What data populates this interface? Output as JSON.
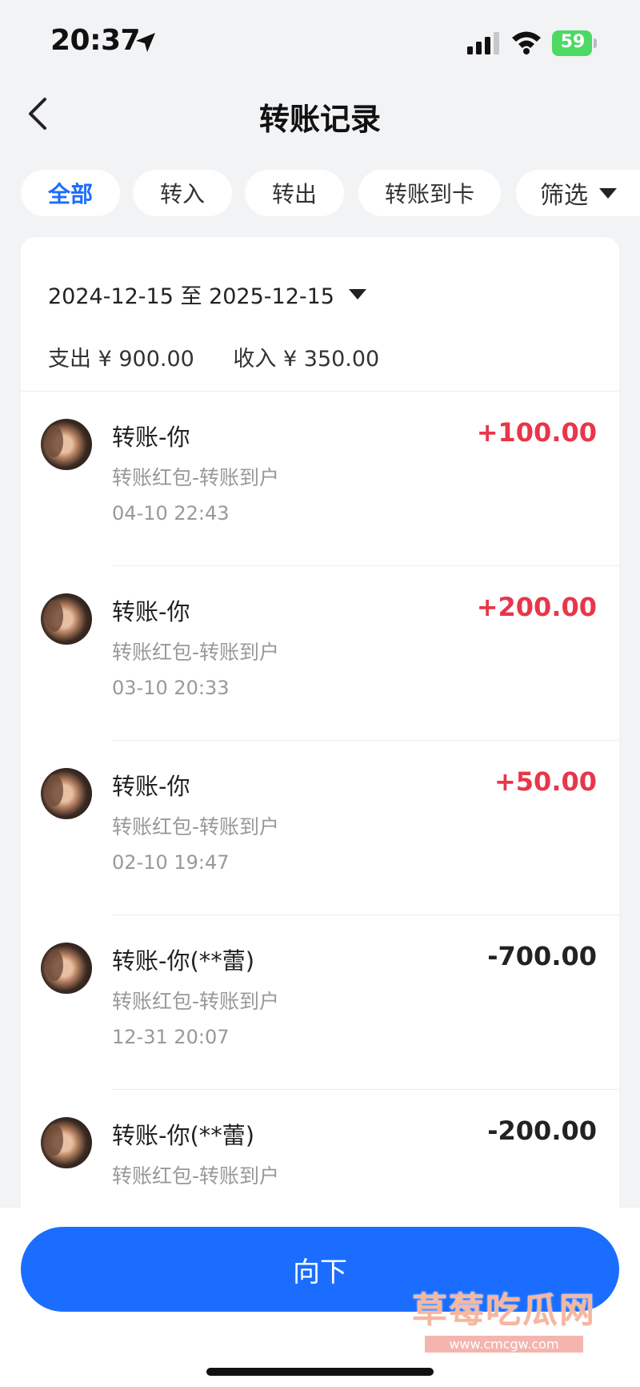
{
  "status_bar": {
    "time": "20:37",
    "battery": "59"
  },
  "header": {
    "title": "转账记录"
  },
  "tabs": [
    {
      "label": "全部",
      "active": true
    },
    {
      "label": "转入",
      "active": false
    },
    {
      "label": "转出",
      "active": false
    },
    {
      "label": "转账到卡",
      "active": false
    }
  ],
  "filter": {
    "label": "筛选"
  },
  "summary": {
    "date_range": "2024-12-15 至 2025-12-15",
    "expense": "支出 ¥ 900.00",
    "income": "收入 ¥ 350.00"
  },
  "records": [
    {
      "name": "转账-你",
      "desc": "转账红包-转账到户",
      "time": "04-10 22:43",
      "amount": "+100.00",
      "type": "income"
    },
    {
      "name": "转账-你",
      "desc": "转账红包-转账到户",
      "time": "03-10 20:33",
      "amount": "+200.00",
      "type": "income"
    },
    {
      "name": "转账-你",
      "desc": "转账红包-转账到户",
      "time": "02-10 19:47",
      "amount": "+50.00",
      "type": "income"
    },
    {
      "name": "转账-你(**蕾)",
      "desc": "转账红包-转账到户",
      "time": "12-31 20:07",
      "amount": "-700.00",
      "type": "expense"
    },
    {
      "name": "转账-你(**蕾)",
      "desc": "转账红包-转账到户",
      "time": "",
      "amount": "-200.00",
      "type": "expense"
    }
  ],
  "bottom": {
    "button_label": "向下"
  },
  "watermark": {
    "title": "草莓吃瓜网",
    "url": "www.cmcgw.com"
  },
  "colors": {
    "accent": "#1a6dff",
    "income": "#e8364a",
    "expense": "#222222",
    "battery": "#4cd964"
  }
}
